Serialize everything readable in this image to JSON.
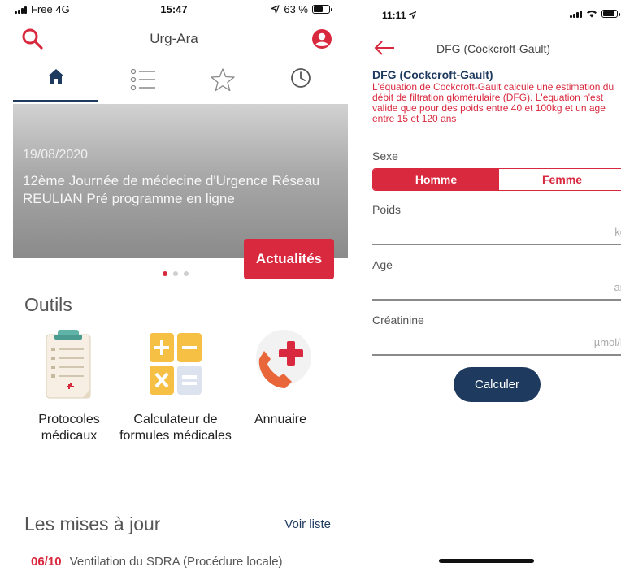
{
  "left_screen": {
    "status": {
      "carrier": "Free 4G",
      "time": "15:47",
      "battery": "63 %"
    },
    "app_title": "Urg-Ara",
    "icons": {
      "search": "search-icon",
      "user": "user-icon"
    },
    "tabs": [
      {
        "name": "home",
        "icon": "home-icon",
        "active": true
      },
      {
        "name": "list",
        "icon": "list-icon",
        "active": false
      },
      {
        "name": "favorites",
        "icon": "star-icon",
        "active": false
      },
      {
        "name": "history",
        "icon": "clock-icon",
        "active": false
      }
    ],
    "hero": {
      "date": "19/08/2020",
      "headline": "12ème Journée de médecine d'Urgence Réseau REULIAN Pré programme en ligne",
      "news_button": "Actualités",
      "carousel_pages": 3,
      "carousel_active_index": 0
    },
    "tools_title": "Outils",
    "tools": [
      {
        "label": "Protocoles médicaux",
        "icon": "clipboard-icon"
      },
      {
        "label": "Calculateur de formules médicales",
        "icon": "calculator-icon"
      },
      {
        "label": "Annuaire",
        "icon": "phone-icon"
      }
    ],
    "updates": {
      "title": "Les mises à jour",
      "see_list": "Voir liste",
      "items": [
        {
          "date": "06/10",
          "text": "Ventilation du SDRA (Procédure locale)"
        }
      ]
    }
  },
  "right_screen": {
    "status": {
      "time": "11:11"
    },
    "nav_title": "DFG (Cockcroft-Gault)",
    "calc_title": "DFG (Cockcroft-Gault)",
    "description": "L'équation de Cockcroft-Gault calcule une estimation du débit de filtration glomérulaire (DFG). L'equation n'est valide que pour des poids entre 40 et 100kg et un age entre 15 et 120 ans",
    "sex": {
      "label": "Sexe",
      "options": [
        "Homme",
        "Femme"
      ],
      "selected": "Homme"
    },
    "fields": [
      {
        "label": "Poids",
        "unit": "kg",
        "value": ""
      },
      {
        "label": "Age",
        "unit": "an",
        "value": ""
      },
      {
        "label": "Créatinine",
        "unit": "µmol/L",
        "value": ""
      }
    ],
    "calculate_button": "Calculer"
  },
  "colors": {
    "accent_red": "#d9293f",
    "navy": "#1e3a5f"
  }
}
